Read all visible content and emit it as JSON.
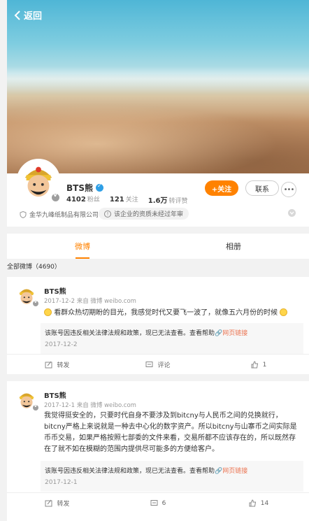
{
  "nav": {
    "back_label": "返回"
  },
  "profile": {
    "name": "BTS熊",
    "followers_count": "4102",
    "followers_label": "粉丝",
    "following_count": "121",
    "following_label": "关注",
    "reposts_count": "1.6万",
    "reposts_label": "转评赞",
    "follow_label": "+关注",
    "contact_label": "联系",
    "more_label": "•••",
    "org": "金华九峰纸制品有限公司",
    "notice": "该企业的资质未经过年审"
  },
  "tabs": [
    {
      "label": "微博"
    },
    {
      "label": "相册"
    }
  ],
  "section_label": "全部微博（4690）",
  "posts": [
    {
      "author": "BTS熊",
      "meta": "2017-12-2 来自 微博 weibo.com",
      "text": "看群众热切期盼的目光，我感觉时代又要飞一波了，就像五六月份的时候",
      "repost_text": "该账号因违反相关法律法规和政策，现已无法查看。查看帮助",
      "repost_link": "网页链接",
      "repost_date": "2017-12-2",
      "repost_label": "转发",
      "comment_label": "评论",
      "like_count": "1"
    },
    {
      "author": "BTS熊",
      "meta": "2017-12-1 来自 微博 weibo.com",
      "text_lines": [
        "我觉得挺安全的，只要时代自身不要涉及到bitcny与人民币之间的兑换就行，",
        "bitcny严格上来说就是一种去中心化的数字资产。所以bitcny与山寨币之间实际是",
        "币币交易，如果严格按照七部委的文件来看，交易所都不应该存在的，所以既然存",
        "在了就不如在模糊的范围内提供尽可能多的方便给客户。"
      ],
      "repost_text": "该账号因违反相关法律法规和政策，现已无法查看。查看帮助",
      "repost_link": "网页链接",
      "repost_date": "2017-12-1",
      "repost_label": "转发",
      "comment_count": "6",
      "like_count": "14"
    }
  ],
  "colors": {
    "accent": "#ff8200",
    "link": "#eb7350",
    "verified": "#2e9fe6"
  }
}
